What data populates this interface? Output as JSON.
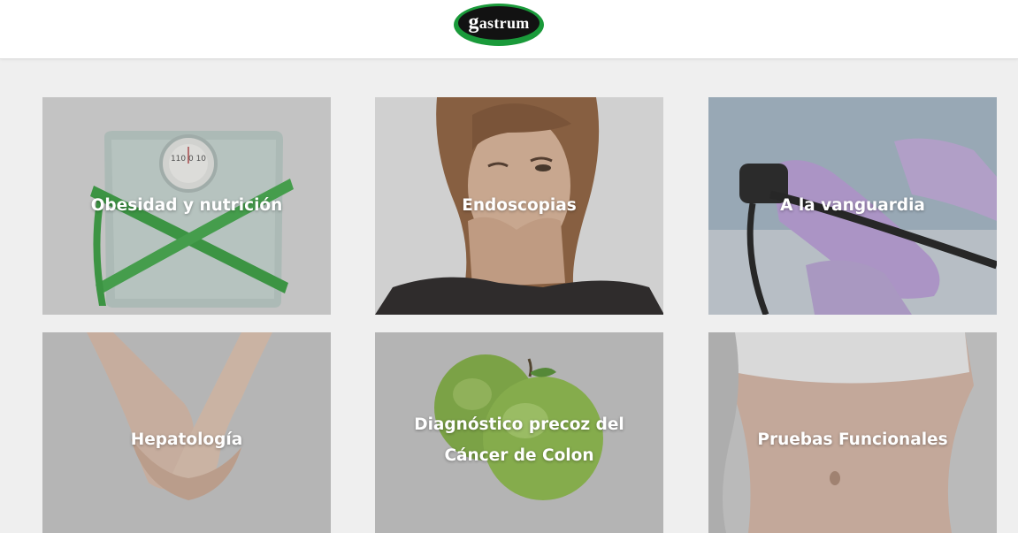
{
  "header": {
    "logo_first_letter": "g",
    "logo_rest": "astrum",
    "logo_colors": {
      "ring": "#1a9a3a",
      "fill": "#111111",
      "text": "#ffffff"
    }
  },
  "tiles": [
    {
      "label": "Obesidad y nutrición",
      "image": "bathroom-scale-tape-measure"
    },
    {
      "label": "Endoscopias",
      "image": "woman-covering-mouth"
    },
    {
      "label": "A la vanguardia",
      "image": "gloved-hands-endoscope"
    },
    {
      "label": "Hepatología",
      "image": "cupped-hands"
    },
    {
      "label": "Diagnóstico precoz del",
      "label_line2": "Cáncer de Colon",
      "image": "green-apples"
    },
    {
      "label": "Pruebas Funcionales",
      "image": "woman-abdomen"
    }
  ],
  "colors": {
    "page_background": "#efefef",
    "header_background": "#ffffff",
    "tile_text": "#ffffff",
    "accent_green": "#1a9a3a"
  }
}
